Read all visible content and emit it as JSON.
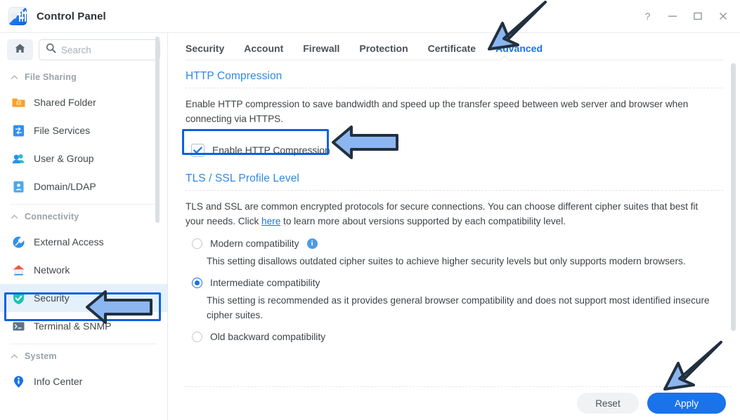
{
  "window": {
    "title": "Control Panel",
    "app_icon": "control-panel-icon",
    "controls": [
      {
        "name": "help-button",
        "glyph": "?"
      },
      {
        "name": "minimize-button",
        "glyph": "—"
      },
      {
        "name": "maximize-button",
        "glyph": "□"
      },
      {
        "name": "close-button",
        "glyph": "✕"
      }
    ]
  },
  "sidebar": {
    "home_label": "home-icon",
    "search": {
      "placeholder": "Search",
      "value": ""
    },
    "groups": [
      {
        "label": "File Sharing",
        "items": [
          {
            "label": "Shared Folder",
            "icon": "folder-icon",
            "selected": false
          },
          {
            "label": "File Services",
            "icon": "file-services-icon",
            "selected": false
          },
          {
            "label": "User & Group",
            "icon": "user-group-icon",
            "selected": false
          },
          {
            "label": "Domain/LDAP",
            "icon": "domain-ldap-icon",
            "selected": false
          }
        ]
      },
      {
        "label": "Connectivity",
        "items": [
          {
            "label": "External Access",
            "icon": "external-access-icon",
            "selected": false
          },
          {
            "label": "Network",
            "icon": "network-icon",
            "selected": false
          },
          {
            "label": "Security",
            "icon": "shield-icon",
            "selected": true
          },
          {
            "label": "Terminal & SNMP",
            "icon": "terminal-icon",
            "selected": false
          }
        ]
      },
      {
        "label": "System",
        "items": [
          {
            "label": "Info Center",
            "icon": "info-center-icon",
            "selected": false
          }
        ]
      }
    ]
  },
  "tabs": [
    {
      "label": "Security",
      "active": false
    },
    {
      "label": "Account",
      "active": false
    },
    {
      "label": "Firewall",
      "active": false
    },
    {
      "label": "Protection",
      "active": false
    },
    {
      "label": "Certificate",
      "active": false
    },
    {
      "label": "Advanced",
      "active": true
    }
  ],
  "sections": {
    "http_compression": {
      "title": "HTTP Compression",
      "description": "Enable HTTP compression to save bandwidth and speed up the transfer speed between web server and browser when connecting via HTTPS.",
      "checkbox": {
        "label": "Enable HTTP Compression",
        "checked": true
      }
    },
    "tls_ssl": {
      "title": "TLS / SSL Profile Level",
      "description_part1": "TLS and SSL are common encrypted protocols for secure connections. You can choose different cipher suites that best fit your needs. Click ",
      "link_text": "here",
      "description_part2": " to learn more about versions supported by each compatibility level.",
      "options": [
        {
          "label": "Modern compatibility",
          "selected": false,
          "has_info": true,
          "description": "This setting disallows outdated cipher suites to achieve higher security levels but only supports modern browsers."
        },
        {
          "label": "Intermediate compatibility",
          "selected": true,
          "has_info": false,
          "description": "This setting is recommended as it provides general browser compatibility and does not support most identified insecure cipher suites."
        },
        {
          "label": "Old backward compatibility",
          "selected": false,
          "has_info": false,
          "description": ""
        }
      ]
    }
  },
  "footer": {
    "reset_label": "Reset",
    "apply_label": "Apply"
  },
  "colors": {
    "accent": "#1a73e8",
    "section_title": "#2f8ae0",
    "annotation_arrow_fill": "#8cb6f0",
    "annotation_arrow_stroke": "#22303f",
    "annotation_box": "#0a62e0",
    "selected_nav_bg": "#e4f1fb"
  },
  "annotations": [
    {
      "name": "arrow-to-advanced-tab",
      "target": "Advanced"
    },
    {
      "name": "arrow-to-enable-http-compression",
      "target": "Enable HTTP Compression"
    },
    {
      "name": "arrow-to-security-nav",
      "target": "Security"
    },
    {
      "name": "arrow-to-apply-button",
      "target": "Apply"
    },
    {
      "name": "highlight-box-enable-http-compression",
      "target": "Enable HTTP Compression"
    },
    {
      "name": "highlight-box-security-nav",
      "target": "Security"
    }
  ]
}
